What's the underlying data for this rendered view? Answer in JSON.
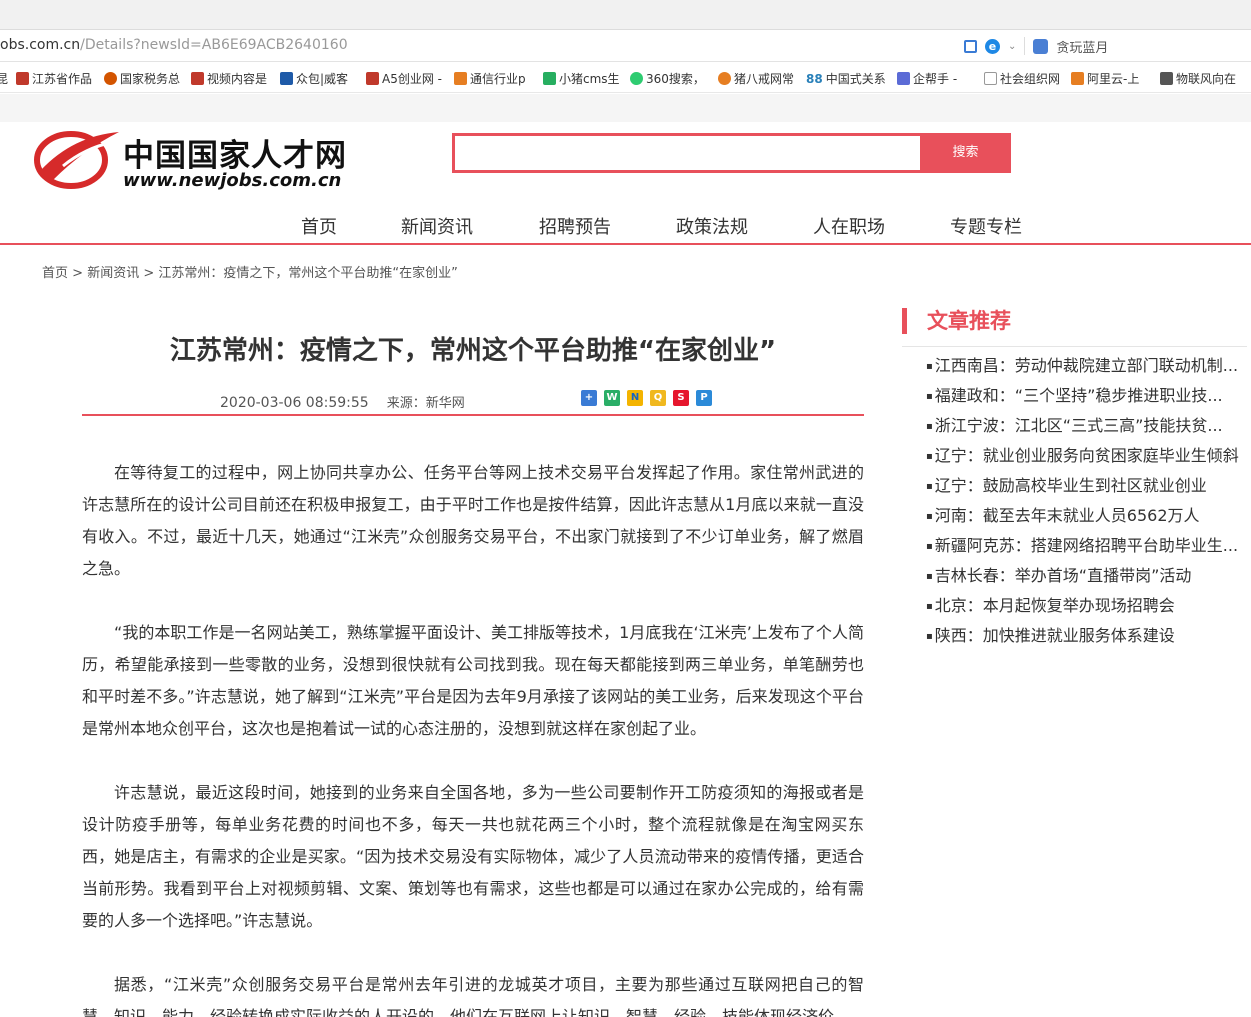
{
  "browser": {
    "url_host": "obs.com.cn",
    "url_path": "/Details?newsId=AB6E69ACB2640160",
    "right_text": "贪玩蓝月",
    "bookmarks": [
      {
        "label": "昆",
        "color": "#888888"
      },
      {
        "label": "江苏省作品",
        "color": "#c0392b"
      },
      {
        "label": "国家税务总",
        "color": "#d35400"
      },
      {
        "label": "视频内容是",
        "color": "#c0392b"
      },
      {
        "label": "众包|威客",
        "color": "#1e5aa8"
      },
      {
        "label": "A5创业网 -",
        "color": "#c0392b"
      },
      {
        "label": "通信行业p",
        "color": "#e67e22"
      },
      {
        "label": "小猪cms生",
        "color": "#27ae60"
      },
      {
        "label": "360搜索，",
        "color": "#2ecc71"
      },
      {
        "label": "猪八戒网常",
        "color": "#e67e22"
      },
      {
        "label": "中国式关系",
        "color": "#2980b9"
      },
      {
        "label": "企帮手 -",
        "color": "#5b6bd6"
      },
      {
        "label": "社会组织网",
        "color": "#999999"
      },
      {
        "label": "阿里云-上",
        "color": "#e67e22"
      },
      {
        "label": "物联风向在",
        "color": "#555555"
      }
    ],
    "bookmark_prefix": {
      "88": "88"
    }
  },
  "site": {
    "logo_cn": "中国国家人才网",
    "logo_url": "www.newjobs.com.cn",
    "search_placeholder": "",
    "search_button": "搜索",
    "nav": [
      "首页",
      "新闻资讯",
      "招聘预告",
      "政策法规",
      "人在职场",
      "专题专栏"
    ]
  },
  "breadcrumb": {
    "home": "首页",
    "section": "新闻资讯",
    "current": "江苏常州：疫情之下，常州这个平台助推“在家创业”",
    "sep": " > "
  },
  "article": {
    "title": "江苏常州：疫情之下，常州这个平台助推“在家创业”",
    "datetime": "2020-03-06 08:59:55",
    "source": "来源：新华网",
    "paragraphs": [
      "在等待复工的过程中，网上协同共享办公、任务平台等网上技术交易平台发挥起了作用。家住常州武进的许志慧所在的设计公司目前还在积极申报复工，由于平时工作也是按件结算，因此许志慧从1月底以来就一直没有收入。不过，最近十几天，她通过“江米壳”众创服务交易平台，不出家门就接到了不少订单业务，解了燃眉之急。",
      "“我的本职工作是一名网站美工，熟练掌握平面设计、美工排版等技术，1月底我在‘江米壳’上发布了个人简历，希望能承接到一些零散的业务，没想到很快就有公司找到我。现在每天都能接到两三单业务，单笔酬劳也和平时差不多。”许志慧说，她了解到“江米壳”平台是因为去年9月承接了该网站的美工业务，后来发现这个平台是常州本地众创平台，这次也是抱着试一试的心态注册的，没想到就这样在家创起了业。",
      "许志慧说，最近这段时间，她接到的业务来自全国各地，多为一些公司要制作开工防疫须知的海报或者是设计防疫手册等，每单业务花费的时间也不多，每天一共也就花两三个小时，整个流程就像是在淘宝网买东西，她是店主，有需求的企业是买家。“因为技术交易没有实际物体，减少了人员流动带来的疫情传播，更适合当前形势。我看到平台上对视频剪辑、文案、策划等也有需求，这些也都是可以通过在家办公完成的，给有需要的人多一个选择吧。”许志慧说。",
      "据悉，“江米壳”众创服务交易平台是常州去年引进的龙城英才项目，主要为那些通过互联网把自己的智慧、知识、能力、经验转换成实际收益的人开设的。他们在互联网上让知识、智慧、经验、技能体现经济价"
    ]
  },
  "sidebar": {
    "heading": "文章推荐",
    "items": [
      "江西南昌：劳动仲裁院建立部门联动机制...",
      "福建政和：“三个坚持”稳步推进职业技...",
      "浙江宁波：江北区“三式三高”技能扶贫...",
      "辽宁：就业创业服务向贫困家庭毕业生倾斜",
      "辽宁：鼓励高校毕业生到社区就业创业",
      "河南：截至去年末就业人员6562万人",
      "新疆阿克苏：搭建网络招聘平台助毕业生...",
      "吉林长春：举办首场“直播带岗”活动",
      "北京：本月起恢复举办现场招聘会",
      "陕西：加快推进就业服务体系建设"
    ]
  },
  "colors": {
    "accent": "#e8505b",
    "text": "#333333"
  }
}
